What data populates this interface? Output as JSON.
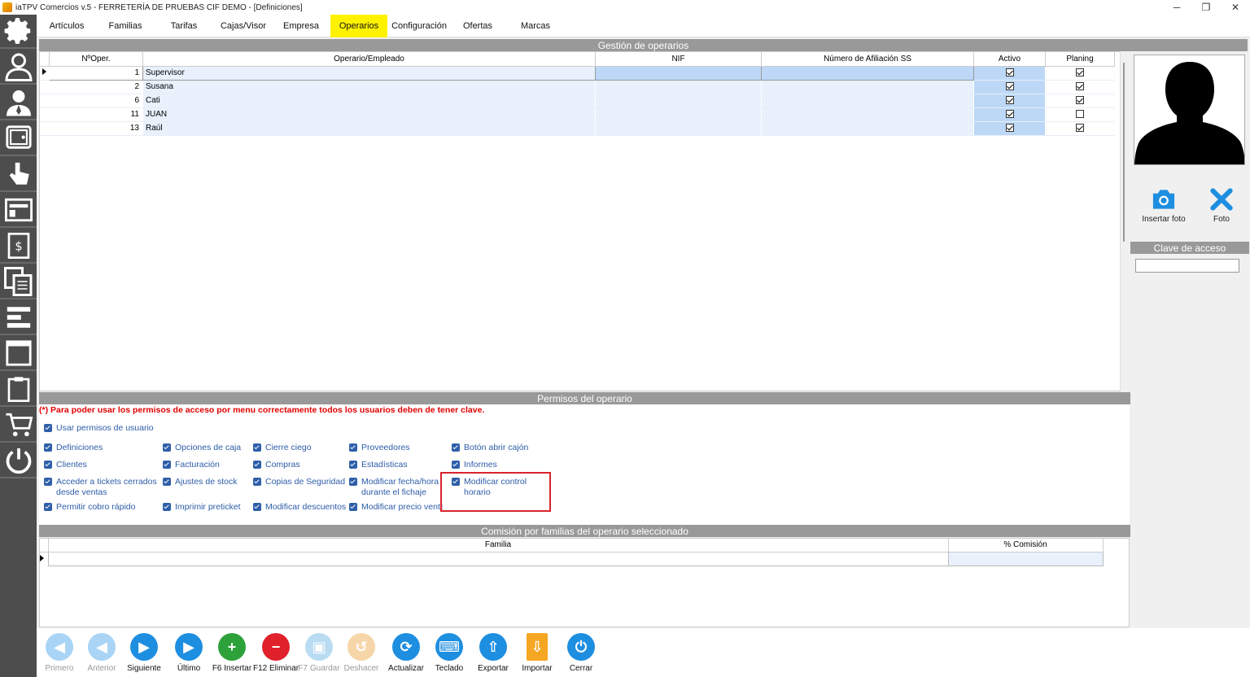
{
  "window": {
    "title": "iaTPV Comercios v.5 - FERRETERÍA DE PRUEBAS CIF DEMO - [Definiciones]",
    "minimize": "─",
    "restore": "❐",
    "close": "✕"
  },
  "tabs": [
    "Artículos",
    "Familias",
    "Tarifas",
    "Cajas/Visor",
    "Empresa",
    "Operarios",
    "Configuración",
    "Ofertas",
    "Marcas"
  ],
  "active_tab": "Operarios",
  "operators": {
    "section_title": "Gestión de operarios",
    "columns": [
      "NºOper.",
      "Operario/Empleado",
      "NIF",
      "Número de Afiliación SS",
      "Activo",
      "Planing"
    ],
    "rows": [
      {
        "num": "1",
        "name": "Supervisor",
        "activo": true,
        "planing": true
      },
      {
        "num": "2",
        "name": "Susana",
        "activo": true,
        "planing": true
      },
      {
        "num": "6",
        "name": "Cati",
        "activo": true,
        "planing": true
      },
      {
        "num": "11",
        "name": "JUAN",
        "activo": true,
        "planing": false
      },
      {
        "num": "13",
        "name": "Raúl",
        "activo": true,
        "planing": true
      }
    ]
  },
  "right_pane": {
    "insert_photo": "Insertar foto",
    "photo": "Foto",
    "clave_title": "Clave de acceso"
  },
  "permissions": {
    "section_title": "Permisos del operario",
    "warning": "(*) Para poder usar los permisos de acceso por menu correctamente todos los usuarios deben de tener clave.",
    "use_perms": "Usar permisos de usuario",
    "col1": [
      "Definiciones",
      "Clientes",
      "Acceder a tickets cerrados desde ventas",
      "Permitir cobro rápido"
    ],
    "col2": [
      "Opciones de caja",
      "Facturación",
      "Ajustes de stock",
      "Imprimir preticket"
    ],
    "col3": [
      "Cierre ciego",
      "Compras",
      "Copias de Seguridad",
      "Modificar descuentos"
    ],
    "col4": [
      "Proveedores",
      "Estadísticas",
      "Modificar fecha/hora durante el fichaje",
      "Modificar precio venta"
    ],
    "col5": [
      "Botón abrir cajón",
      "Informes",
      "Modificar control horario"
    ]
  },
  "commission": {
    "section_title": "Comisión por familias del operario seleccionado",
    "columns": [
      "Familia",
      "% Comisión"
    ]
  },
  "toolbar": [
    {
      "label": "Primero",
      "icon": "first-icon",
      "color": "#a9d4f5",
      "enabled": false
    },
    {
      "label": "Anterior",
      "icon": "previous-icon",
      "color": "#a9d4f5",
      "enabled": false
    },
    {
      "label": "Siguiente",
      "icon": "next-icon",
      "color": "#1e8ee0",
      "enabled": true
    },
    {
      "label": "Último",
      "icon": "last-icon",
      "color": "#1e8ee0",
      "enabled": true
    },
    {
      "label": "F6 Insertar",
      "icon": "plus-icon",
      "color": "#2ea23a",
      "enabled": true
    },
    {
      "label": "F12 Eliminar",
      "icon": "minus-icon",
      "color": "#e0202a",
      "enabled": true
    },
    {
      "label": "F7 Guardar",
      "icon": "save-icon",
      "color": "#b9dcf2",
      "enabled": false
    },
    {
      "label": "Deshacer",
      "icon": "undo-icon",
      "color": "#f6d6a8",
      "enabled": false
    },
    {
      "label": "Actualizar",
      "icon": "refresh-icon",
      "color": "#1e8ee0",
      "enabled": true
    },
    {
      "label": "Teclado",
      "icon": "keyboard-icon",
      "color": "#1e8ee0",
      "enabled": true
    },
    {
      "label": "Exportar",
      "icon": "export-icon",
      "color": "#1e8ee0",
      "enabled": true
    },
    {
      "label": "Importar",
      "icon": "import-icon",
      "color": "#f5a623",
      "enabled": true
    },
    {
      "label": "Cerrar",
      "icon": "power-icon",
      "color": "#1e8ee0",
      "enabled": true
    }
  ]
}
